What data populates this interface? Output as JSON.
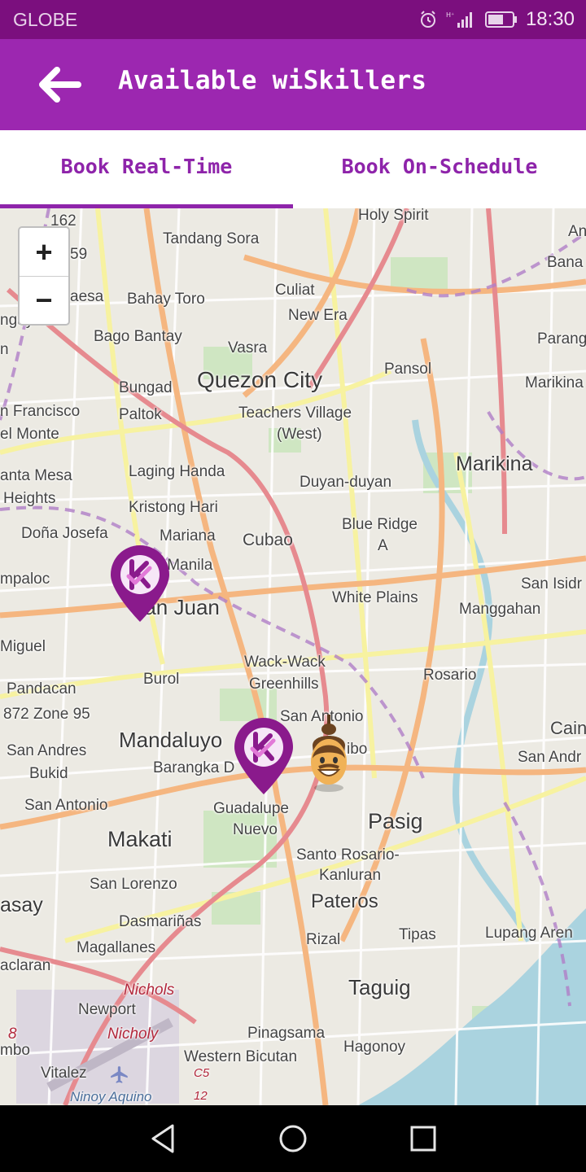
{
  "status_bar": {
    "carrier": "GLOBE",
    "time": "18:30",
    "icons": [
      "alarm-icon",
      "signal-icon",
      "battery-icon"
    ]
  },
  "app_bar": {
    "title": "Available wiSkillers",
    "back_icon": "arrow-left-icon"
  },
  "tabs": [
    {
      "label": "Book Real-Time",
      "active": true
    },
    {
      "label": "Book On-Schedule",
      "active": false
    }
  ],
  "map": {
    "zoom_in": "+",
    "zoom_out": "−",
    "labels": {
      "l162": "162",
      "l59": "59",
      "holy_spirit": "Holy Spirit",
      "an": "An",
      "bana": "Bana",
      "tandang_sora": "Tandang Sora",
      "culiat": "Culiat",
      "aesa": "aesa",
      "bahay_toro": "Bahay Toro",
      "new_era": "New Era",
      "ngaylo": "ngay lo",
      "bago_bantay": "Bago Bantay",
      "parang": "Parang",
      "vasra": "Vasra",
      "n": "n",
      "pansol": "Pansol",
      "quezon_city": "Quezon City",
      "marikina_top": "Marikina",
      "bungad": "Bungad",
      "francisco": "n Francisco",
      "paltok": "Paltok",
      "teachers_village": "Teachers Village",
      "west": "(West)",
      "el_monte": "el Monte",
      "marikina": "Marikina",
      "laging_handa": "Laging Handa",
      "anta_mesa": "anta Mesa",
      "duyan_duyan": "Duyan-duyan",
      "heights": "Heights",
      "kristong_hari": "Kristong Hari",
      "blue_ridge": "Blue Ridge",
      "blue_ridge_a": "A",
      "dona_josefa": "Doña Josefa",
      "mariana": "Mariana",
      "cubao": "Cubao",
      "new_manila": "New Manila",
      "mpaloc": "mpaloc",
      "san_juan": "San Juan",
      "san_isidro": "San Isidr",
      "white_plains": "White Plains",
      "manggahan": "Manggahan",
      "miguel": "Miguel",
      "wack_wack": "Wack-Wack",
      "greenhills": "Greenhills",
      "burol": "Burol",
      "rosario": "Rosario",
      "pandacan": "Pandacan",
      "zone95": "872 Zone 95",
      "san_antonio": "San Antonio",
      "cain": "Cain",
      "mandaluyong": "Mandaluyo",
      "san_andres": "San Andres",
      "san_andres_right": "San Andr",
      "ibo": "ibo",
      "bukid": "Bukid",
      "barangka": "Barangka D",
      "san_antonio_left": "San Antonio",
      "guadalupe": "Guadalupe",
      "nuevo": "Nuevo",
      "pasig": "Pasig",
      "makati": "Makati",
      "santo_rosario": "Santo Rosario-",
      "kanluran": "Kanluran",
      "san_lorenzo": "San Lorenzo",
      "pateros": "Pateros",
      "asay": "asay",
      "dasmarinas": "Dasmariñas",
      "rizal": "Rizal",
      "tipas": "Tipas",
      "lupang_arenas": "Lupang Aren",
      "magallanes": "Magallanes",
      "aclaran": "aclaran",
      "nichols": "Nichols",
      "taguig": "Taguig",
      "newport": "Newport",
      "nicholy": "Nicholy",
      "pinagsama": "Pinagsama",
      "l8": "8",
      "hagonoy": "Hagonoy",
      "mbo": "mbo",
      "western_bicutan": "Western Bicutan",
      "vitalez": "Vitalez",
      "c5": "C5",
      "ninoy_aquino": "Ninoy Aquino",
      "l12": "12"
    },
    "markers": [
      "wiskiller-pin-icon",
      "wiskiller-pin-icon",
      "user-avatar-icon"
    ]
  },
  "nav_bar": {
    "icons": [
      "back-triangle-icon",
      "home-circle-icon",
      "recents-square-icon"
    ]
  },
  "colors": {
    "status_bar": "#7b0f7e",
    "app_bar": "#9c27b0",
    "accent": "#8e24aa",
    "pin": "#8a1a8c"
  }
}
